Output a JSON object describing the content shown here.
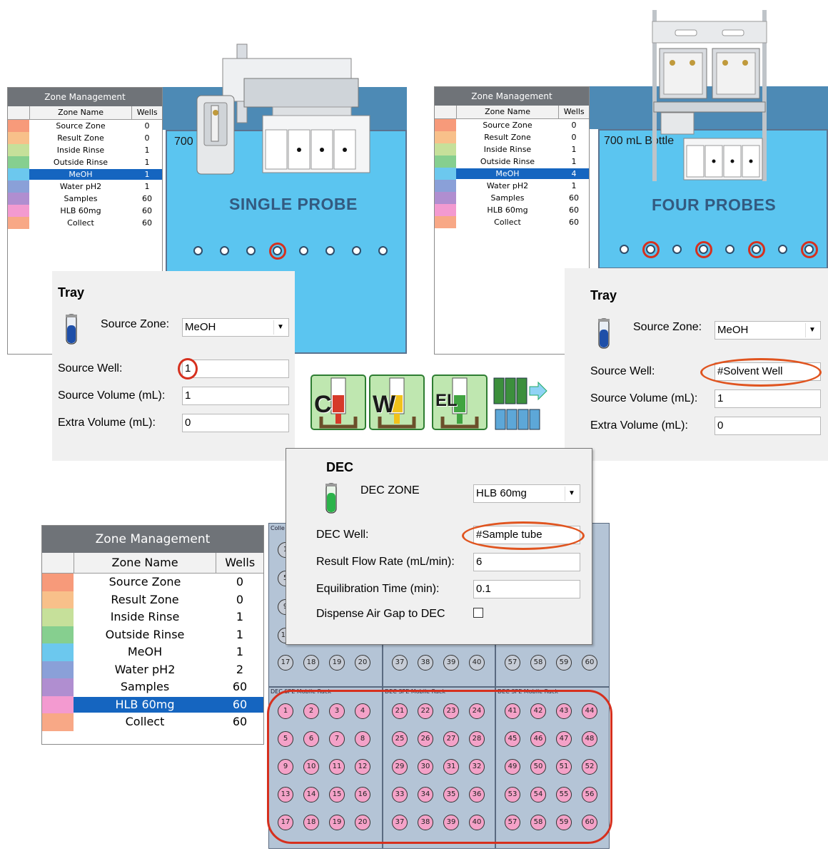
{
  "zone_management": {
    "title": "Zone Management",
    "col_name": "Zone Name",
    "col_wells": "Wells"
  },
  "single": {
    "zones": [
      {
        "name": "Source Zone",
        "wells": "0",
        "color": "#f79a7a"
      },
      {
        "name": "Result Zone",
        "wells": "0",
        "color": "#f8c08a"
      },
      {
        "name": "Inside Rinse",
        "wells": "1",
        "color": "#c6e09a"
      },
      {
        "name": "Outside Rinse",
        "wells": "1",
        "color": "#86cf8f"
      },
      {
        "name": "MeOH",
        "wells": "1",
        "color": "#6cc8ee",
        "selected": true
      },
      {
        "name": "Water pH2",
        "wells": "1",
        "color": "#8aa0d8"
      },
      {
        "name": "Samples",
        "wells": "60",
        "color": "#b08ed0"
      },
      {
        "name": "HLB 60mg",
        "wells": "60",
        "color": "#f39ad0"
      },
      {
        "name": "Collect",
        "wells": "60",
        "color": "#f8a886"
      }
    ],
    "bottle_label": "700",
    "probe_title": "SINGLE PROBE",
    "tray": {
      "title": "Tray",
      "source_zone_label": "Source Zone:",
      "source_zone_value": "MeOH",
      "source_well_label": "Source Well:",
      "source_well_value": "1",
      "source_volume_label": "Source Volume (mL):",
      "source_volume_value": "1",
      "extra_volume_label": "Extra Volume (mL):",
      "extra_volume_value": "0"
    }
  },
  "four": {
    "zones": [
      {
        "name": "Source Zone",
        "wells": "0",
        "color": "#f79a7a"
      },
      {
        "name": "Result Zone",
        "wells": "0",
        "color": "#f8c08a"
      },
      {
        "name": "Inside Rinse",
        "wells": "1",
        "color": "#c6e09a"
      },
      {
        "name": "Outside Rinse",
        "wells": "1",
        "color": "#86cf8f"
      },
      {
        "name": "MeOH",
        "wells": "4",
        "color": "#6cc8ee",
        "selected": true
      },
      {
        "name": "Water pH2",
        "wells": "1",
        "color": "#8aa0d8"
      },
      {
        "name": "Samples",
        "wells": "60",
        "color": "#b08ed0"
      },
      {
        "name": "HLB 60mg",
        "wells": "60",
        "color": "#f39ad0"
      },
      {
        "name": "Collect",
        "wells": "60",
        "color": "#f8a886"
      }
    ],
    "bottle_label": "700 mL Bottle",
    "probe_title": "FOUR PROBES",
    "tray": {
      "title": "Tray",
      "source_zone_label": "Source Zone:",
      "source_zone_value": "MeOH",
      "source_well_label": "Source Well:",
      "source_well_value": "#Solvent Well",
      "source_volume_label": "Source Volume (mL):",
      "source_volume_value": "1",
      "extra_volume_label": "Extra Volume (mL):",
      "extra_volume_value": "0"
    }
  },
  "bottom_zones": [
    {
      "name": "Source Zone",
      "wells": "0",
      "color": "#f79a7a"
    },
    {
      "name": "Result Zone",
      "wells": "0",
      "color": "#f8c08a"
    },
    {
      "name": "Inside Rinse",
      "wells": "1",
      "color": "#c6e09a"
    },
    {
      "name": "Outside Rinse",
      "wells": "1",
      "color": "#86cf8f"
    },
    {
      "name": "MeOH",
      "wells": "1",
      "color": "#6cc8ee"
    },
    {
      "name": "Water pH2",
      "wells": "2",
      "color": "#8aa0d8"
    },
    {
      "name": "Samples",
      "wells": "60",
      "color": "#b08ed0"
    },
    {
      "name": "HLB 60mg",
      "wells": "60",
      "color": "#f39ad0",
      "selected": true
    },
    {
      "name": "Collect",
      "wells": "60",
      "color": "#f8a886"
    }
  ],
  "step_icons": [
    {
      "letter": "C",
      "name": "condition-step-icon"
    },
    {
      "letter": "W",
      "name": "wash-step-icon"
    },
    {
      "letter": "EL",
      "name": "elute-step-icon"
    },
    {
      "letter": "",
      "name": "transfer-step-icon"
    }
  ],
  "dec": {
    "title": "DEC",
    "zone_label": "DEC ZONE",
    "zone_value": "HLB 60mg",
    "well_label": "DEC Well:",
    "well_value": "#Sample tube",
    "flow_label": "Result Flow Rate (mL/min):",
    "flow_value": "6",
    "equil_label": "Equilibration Time (min):",
    "equil_value": "0.1",
    "air_gap_label": "Dispense Air Gap to DEC"
  },
  "rack": {
    "collect_label": "Colle",
    "rack_label": "DEC SPE Mobile Rack",
    "top_columns": [
      [
        "17",
        "18",
        "19",
        "20"
      ],
      [
        "37",
        "38",
        "39",
        "40"
      ],
      [
        "57",
        "58",
        "59",
        "60"
      ]
    ],
    "top_hidden_left": [
      "1",
      "5",
      "9",
      "13"
    ],
    "bottom_columns": [
      [
        [
          "1",
          "2",
          "3",
          "4"
        ],
        [
          "5",
          "6",
          "7",
          "8"
        ],
        [
          "9",
          "10",
          "11",
          "12"
        ],
        [
          "13",
          "14",
          "15",
          "16"
        ],
        [
          "17",
          "18",
          "19",
          "20"
        ]
      ],
      [
        [
          "21",
          "22",
          "23",
          "24"
        ],
        [
          "25",
          "26",
          "27",
          "28"
        ],
        [
          "29",
          "30",
          "31",
          "32"
        ],
        [
          "33",
          "34",
          "35",
          "36"
        ],
        [
          "37",
          "38",
          "39",
          "40"
        ]
      ],
      [
        [
          "41",
          "42",
          "43",
          "44"
        ],
        [
          "45",
          "46",
          "47",
          "48"
        ],
        [
          "49",
          "50",
          "51",
          "52"
        ],
        [
          "53",
          "54",
          "55",
          "56"
        ],
        [
          "57",
          "58",
          "59",
          "60"
        ]
      ]
    ]
  }
}
